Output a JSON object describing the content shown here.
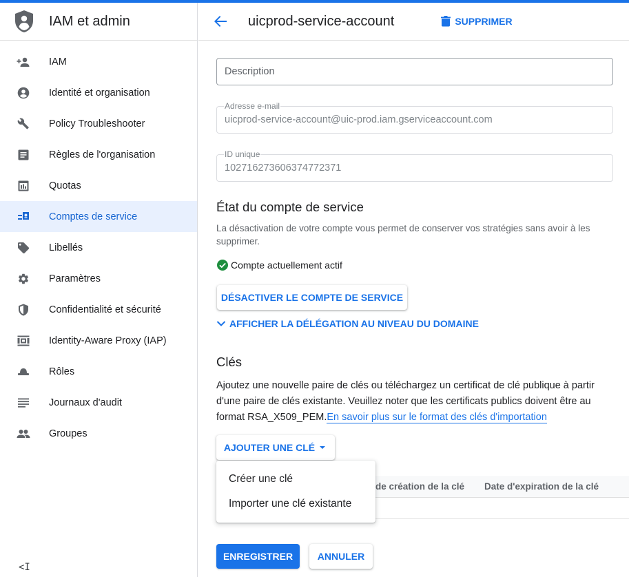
{
  "app": {
    "title": "IAM et admin",
    "accent_color": "#1a73e8"
  },
  "sidebar": {
    "items": [
      {
        "label": "IAM",
        "icon": "person-add-icon",
        "active": false
      },
      {
        "label": "Identité et organisation",
        "icon": "account-circle-icon",
        "active": false
      },
      {
        "label": "Policy Troubleshooter",
        "icon": "wrench-icon",
        "active": false
      },
      {
        "label": "Règles de l'organisation",
        "icon": "document-icon",
        "active": false
      },
      {
        "label": "Quotas",
        "icon": "quota-icon",
        "active": false
      },
      {
        "label": "Comptes de service",
        "icon": "service-account-icon",
        "active": true
      },
      {
        "label": "Libellés",
        "icon": "tag-icon",
        "active": false
      },
      {
        "label": "Paramètres",
        "icon": "gear-icon",
        "active": false
      },
      {
        "label": "Confidentialité et sécurité",
        "icon": "shield-icon",
        "active": false
      },
      {
        "label": "Identity-Aware Proxy (IAP)",
        "icon": "iap-icon",
        "active": false
      },
      {
        "label": "Rôles",
        "icon": "roles-hat-icon",
        "active": false
      },
      {
        "label": "Journaux d'audit",
        "icon": "list-lines-icon",
        "active": false
      },
      {
        "label": "Groupes",
        "icon": "group-icon",
        "active": false
      }
    ],
    "collapse_label": "<I"
  },
  "header": {
    "title": "uicprod-service-account",
    "delete_label": "SUPPRIMER"
  },
  "form": {
    "description_placeholder": "Description",
    "email_label": "Adresse e-mail",
    "email_value": "uicprod-service-account@uic-prod.iam.gserviceaccount.com",
    "unique_id_label": "ID unique",
    "unique_id_value": "102716273606374772371"
  },
  "status_section": {
    "heading": "État du compte de service",
    "description": "La désactivation de votre compte vous permet de conserver vos stratégies sans avoir à les supprimer.",
    "status_text": "Compte actuellement actif",
    "disable_button": "DÉSACTIVER LE COMPTE DE SERVICE",
    "delegation_toggle": "AFFICHER LA DÉLÉGATION AU NIVEAU DU DOMAINE"
  },
  "keys_section": {
    "heading": "Clés",
    "description": "Ajoutez une nouvelle paire de clés ou téléchargez un certificat de clé publique à partir d'une paire de clés existante. Veuillez noter que les certificats publics doivent être au format RSA_X509_PEM.",
    "link_text": "En savoir plus sur le format des clés d'importation",
    "add_key_button": "AJOUTER UNE CLÉ",
    "table_headers": [
      "de création de la clé",
      "Date d'expiration de la clé"
    ],
    "menu_items": [
      "Créer une clé",
      "Importer une clé existante"
    ]
  },
  "footer": {
    "save_label": "ENREGISTRER",
    "cancel_label": "ANNULER"
  }
}
